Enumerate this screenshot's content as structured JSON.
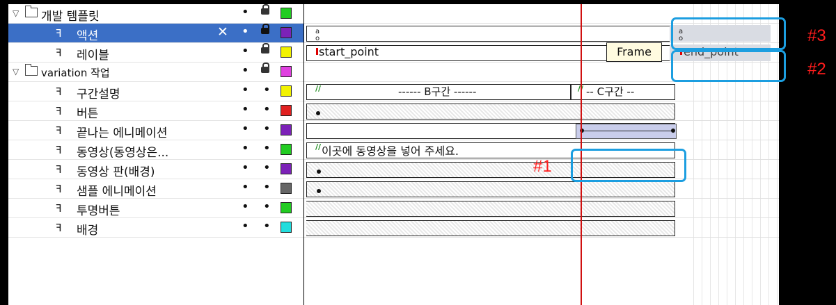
{
  "layers": [
    {
      "name": "개발 템플릿",
      "type": "folder",
      "expanded": true,
      "visibility": "•",
      "locked": true,
      "color": "#22cc22",
      "selected": false
    },
    {
      "name": "액션",
      "type": "layer",
      "visibility": "•",
      "locked": true,
      "color": "#7c22b8",
      "selected": true,
      "editing_icon": "pencil-crossed-icon"
    },
    {
      "name": "레이블",
      "type": "layer",
      "visibility": "•",
      "locked": true,
      "color": "#f2f200",
      "selected": false
    },
    {
      "name": "variation 작업",
      "type": "folder",
      "expanded": true,
      "visibility": "•",
      "locked": true,
      "color": "#e040e0",
      "selected": false
    },
    {
      "name": "구간설명",
      "type": "layer",
      "visibility": "•",
      "visibility2": "•",
      "color": "#f2f200",
      "selected": false
    },
    {
      "name": "버튼",
      "type": "layer",
      "visibility": "•",
      "visibility2": "•",
      "color": "#e02020",
      "selected": false
    },
    {
      "name": "끝나는 에니메이션",
      "type": "layer",
      "visibility": "•",
      "visibility2": "•",
      "color": "#7c22b8",
      "selected": false
    },
    {
      "name": "동영상(동영상은...",
      "type": "layer",
      "visibility": "•",
      "visibility2": "•",
      "color": "#22cc22",
      "selected": false
    },
    {
      "name": "동영상 판(배경)",
      "type": "layer",
      "visibility": "•",
      "visibility2": "•",
      "color": "#7c22b8",
      "selected": false
    },
    {
      "name": "샘플 에니메이션",
      "type": "layer",
      "visibility": "•",
      "visibility2": "•",
      "color": "#666666",
      "selected": false
    },
    {
      "name": "투명버튼",
      "type": "layer",
      "visibility": "•",
      "visibility2": "•",
      "color": "#22cc22",
      "selected": false
    },
    {
      "name": "배경",
      "type": "layer",
      "visibility": "•",
      "visibility2": "•",
      "color": "#22dddd",
      "selected": false
    }
  ],
  "timeline": {
    "label_start": "start_point",
    "label_end": "end_point",
    "section_b": "------ B구간 ------",
    "section_c": "-- C구간 --",
    "video_note": "이곳에 동영상을 넣어 주세요.",
    "tooltip": "Frame"
  },
  "annotations": {
    "tag1": "#1",
    "tag2": "#2",
    "tag3": "#3",
    "callout_color": "#1c9ee0",
    "tag_color": "#ff1c1c"
  }
}
